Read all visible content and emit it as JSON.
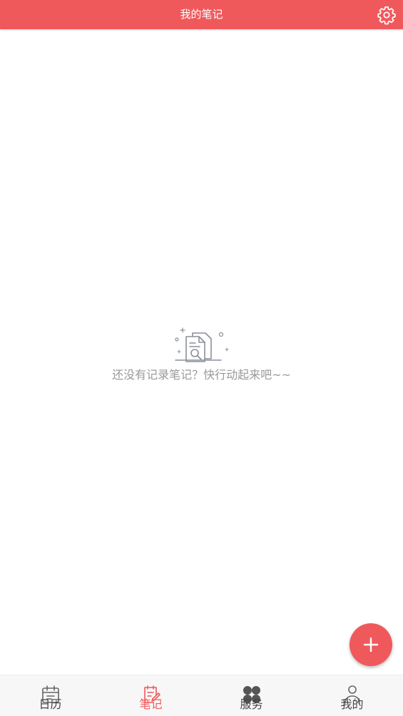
{
  "header": {
    "title": "我的笔记",
    "settings_icon": "gear-icon"
  },
  "empty_state": {
    "icon": "document-search-icon",
    "message": "还没有记录笔记？快行动起来吧~~"
  },
  "fab": {
    "icon": "plus-icon"
  },
  "tabs": [
    {
      "label": "日历",
      "icon": "calendar-icon",
      "active": false
    },
    {
      "label": "笔记",
      "icon": "note-edit-icon",
      "active": true
    },
    {
      "label": "服务",
      "icon": "apps-icon",
      "active": false
    },
    {
      "label": "我的",
      "icon": "person-icon",
      "active": false
    }
  ],
  "colors": {
    "accent": "#f0595c",
    "muted_text": "#999999",
    "tab_text": "#444444",
    "tabbar_bg": "#f7f7f7"
  }
}
